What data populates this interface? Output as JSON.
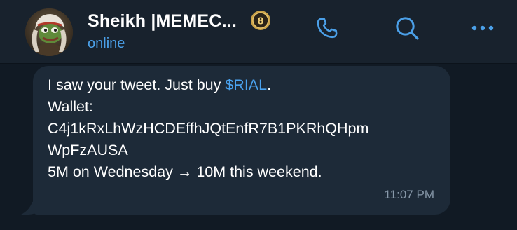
{
  "header": {
    "contact_name": "Sheikh |MEMEC...",
    "badge_number": "8",
    "status": "online",
    "icons": {
      "avatar": "avatar",
      "call": "phone-icon",
      "search": "search-icon",
      "more": "more-dots-icon"
    }
  },
  "message": {
    "line1_prefix": "I saw your tweet. Just buy ",
    "cashtag": "$RIAL",
    "line1_suffix": ".",
    "line2": "Wallet:",
    "line3": "C4j1kRxLhWzHCDEffhJQtEnfR7B1PKRhQHpm",
    "line4": "WpFzAUSA",
    "line5": "5M on Wednesday → 10M this weekend.",
    "time": "11:07 PM"
  },
  "colors": {
    "background": "#111a24",
    "header": "#18222d",
    "bubble": "#1d2a38",
    "accent": "#4ba0e8",
    "timestamp": "#8899aa",
    "badge": "#c9a24a"
  }
}
